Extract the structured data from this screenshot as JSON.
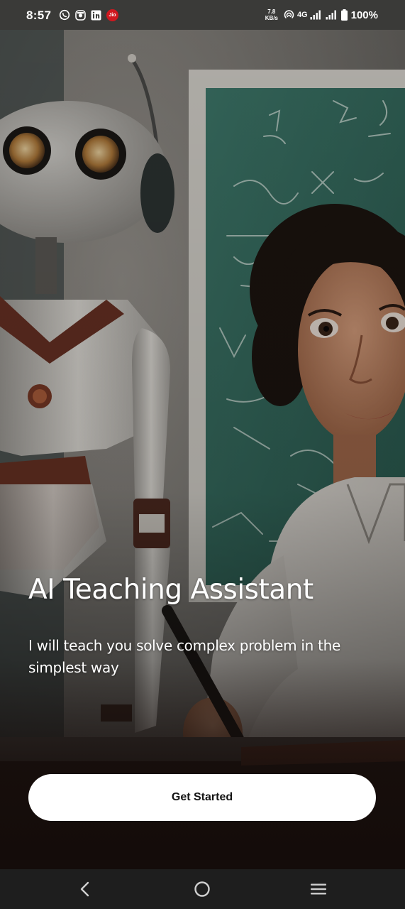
{
  "status_bar": {
    "time": "8:57",
    "app_icons": [
      "whatsapp-icon",
      "instagram-icon",
      "linkedin-icon",
      "jio-icon"
    ],
    "jio_label": "Jio",
    "net_speed_value": "7.8",
    "net_speed_unit": "KB/s",
    "network_type": "4G",
    "battery": "100%"
  },
  "hero": {
    "image_subject": "robot-and-teacher-classroom-illustration"
  },
  "onboarding": {
    "title": "AI Teaching Assistant",
    "subtitle": "I will teach you solve complex problem in the simplest way",
    "cta_label": "Get Started"
  },
  "nav_bar": {
    "buttons": [
      "back-icon",
      "home-icon",
      "recent-apps-icon"
    ]
  },
  "colors": {
    "status_bar": "#3a3a38",
    "button_background": "#ffffff",
    "button_text": "#141414",
    "text": "#ffffff",
    "nav_bar": "#1e1e1e"
  }
}
